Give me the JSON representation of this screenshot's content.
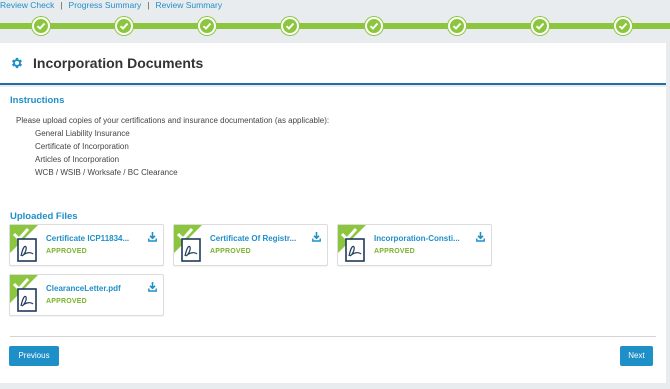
{
  "top_links": {
    "review_check": "Review Check",
    "progress_summary": "Progress Summary",
    "review_summary": "Review Summary",
    "separator": "|"
  },
  "progress": {
    "steps_total": 8,
    "steps_completed": 8,
    "color": "#8cc63f"
  },
  "header": {
    "icon": "gear-icon",
    "title": "Incorporation Documents"
  },
  "instructions": {
    "heading": "Instructions",
    "intro": "Please upload copies of your certifications and insurance documentation (as applicable):",
    "documents": [
      "General Liability Insurance",
      "Certificate of Incorporation",
      "Articles of Incorporation",
      "WCB / WSIB / Worksafe / BC Clearance"
    ]
  },
  "uploaded": {
    "heading": "Uploaded Files",
    "files": [
      {
        "name": "Certificate ICP11834...",
        "status": "APPROVED"
      },
      {
        "name": "Certificate Of Registr...",
        "status": "APPROVED"
      },
      {
        "name": "Incorporation-Consti...",
        "status": "APPROVED"
      },
      {
        "name": "ClearanceLetter.pdf",
        "status": "APPROVED"
      }
    ]
  },
  "buttons": {
    "previous": "Previous",
    "next": "Next"
  },
  "colors": {
    "accent": "#1f8fc8",
    "approved": "#7ab22e",
    "header_rule": "#1f6fa3"
  }
}
